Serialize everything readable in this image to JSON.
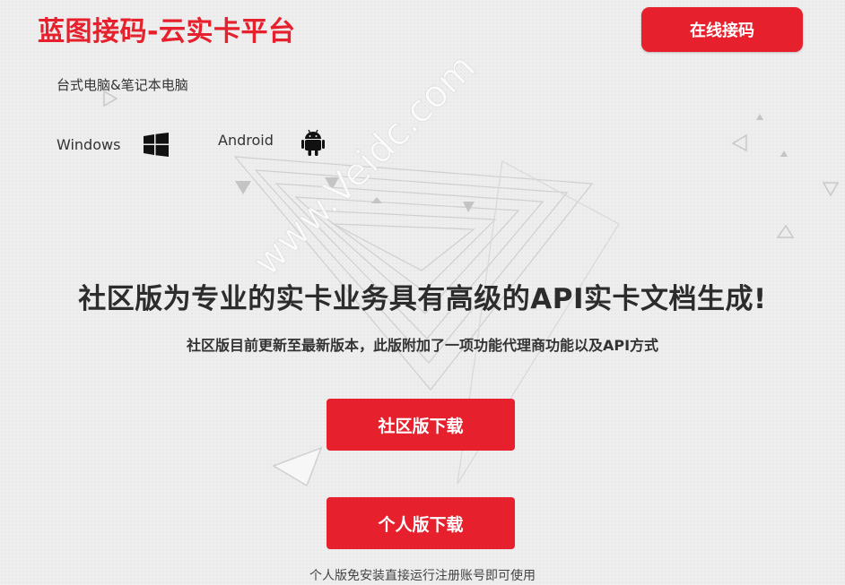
{
  "header": {
    "logo": "蓝图接码-云实卡平台",
    "online_button": "在线接码"
  },
  "platforms": {
    "title": "台式电脑&笔记本电脑",
    "windows_label": "Windows",
    "android_label": "Android",
    "windows_icon": "windows-logo-icon",
    "android_icon": "android-robot-icon"
  },
  "hero": {
    "headline": "社区版为专业的实卡业务具有高级的API实卡文档生成!",
    "subline": "社区版目前更新至最新版本，此版附加了一项功能代理商功能以及API方式"
  },
  "downloads": {
    "community_label": "社区版下载",
    "personal_label": "个人版下载",
    "personal_note": "个人版免安装直接运行注册账号即可使用"
  },
  "watermark": "www.Veidc.com",
  "colors": {
    "brand_red": "#e6212d",
    "background": "#eeeeee",
    "text_dark": "#2c2c2c"
  }
}
